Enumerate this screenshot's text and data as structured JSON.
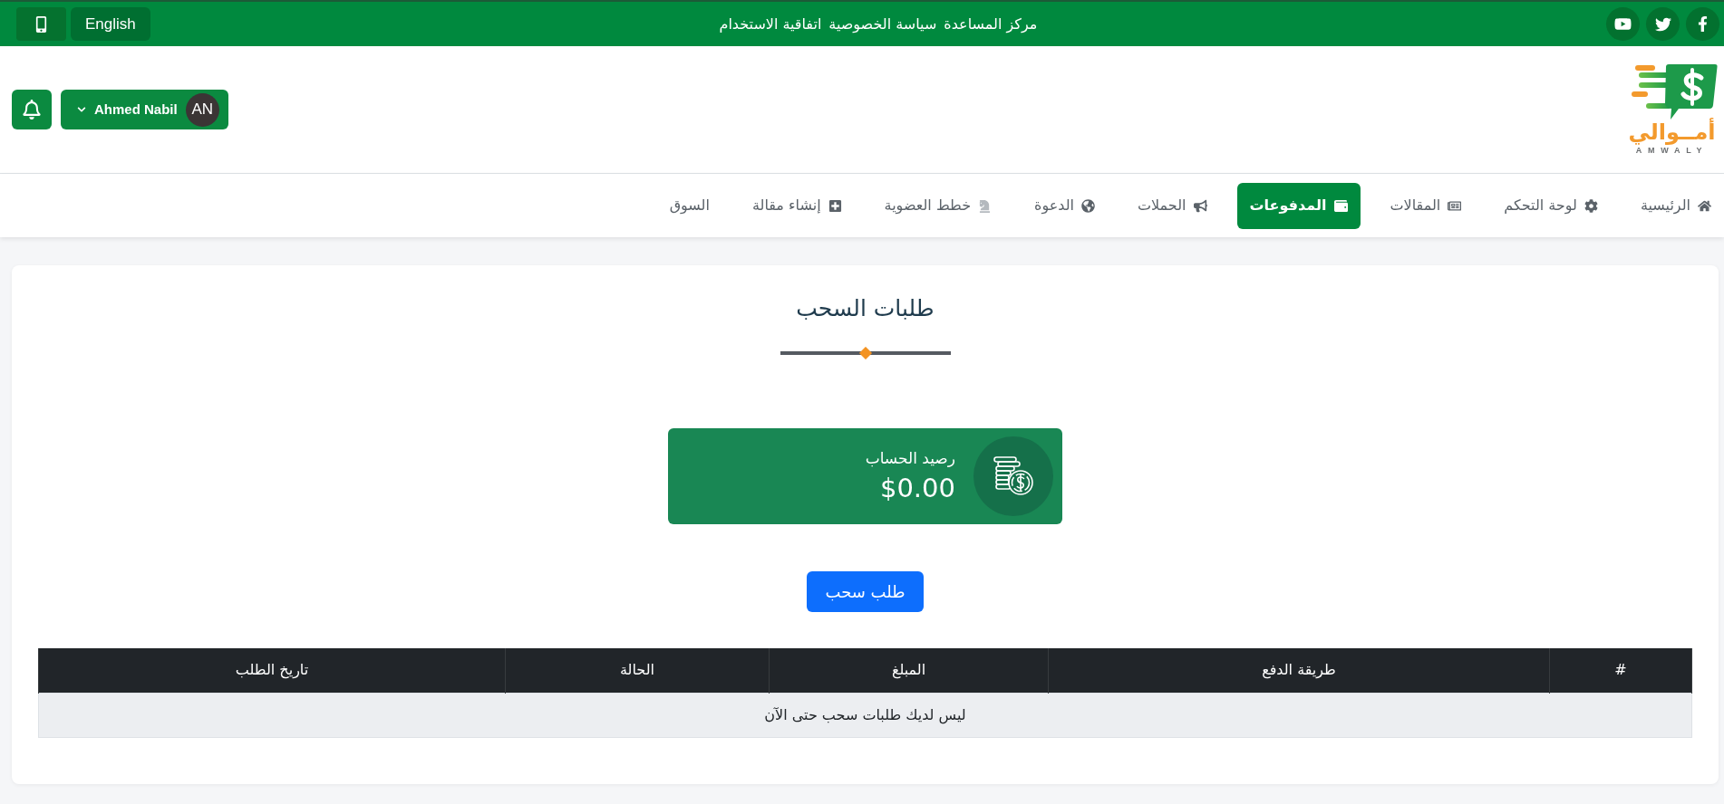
{
  "top_bar": {
    "language_button": "English",
    "links": [
      "مركز المساعدة",
      "سياسة الخصوصية",
      "اتفاقية الاستخدام"
    ]
  },
  "header": {
    "logo": {
      "wordmark": "أمــوالي",
      "tagline": "AMWALY"
    },
    "user": {
      "name": "Ahmed Nabil",
      "initials": "AN"
    }
  },
  "nav": [
    {
      "label": "الرئيسية",
      "selected": false
    },
    {
      "label": "لوحة التحكم",
      "selected": false
    },
    {
      "label": "المقالات",
      "selected": false
    },
    {
      "label": "المدفوعات",
      "selected": true
    },
    {
      "label": "الحملات",
      "selected": false
    },
    {
      "label": "الدعوة",
      "selected": false
    },
    {
      "label": "خطط العضوية",
      "selected": false
    },
    {
      "label": "إنشاء مقالة",
      "selected": false
    },
    {
      "label": "السوق",
      "selected": false
    }
  ],
  "page": {
    "title": "طلبات السحب",
    "balance": {
      "label": "رصيد الحساب",
      "amount": "$0.00"
    },
    "withdraw_button": "طلب سحب",
    "table": {
      "columns": [
        "#",
        "طريقة الدفع",
        "المبلغ",
        "الحالة",
        "تاريخ الطلب"
      ],
      "empty_message": "ليس لديك طلبات سحب حتى الآن"
    }
  }
}
